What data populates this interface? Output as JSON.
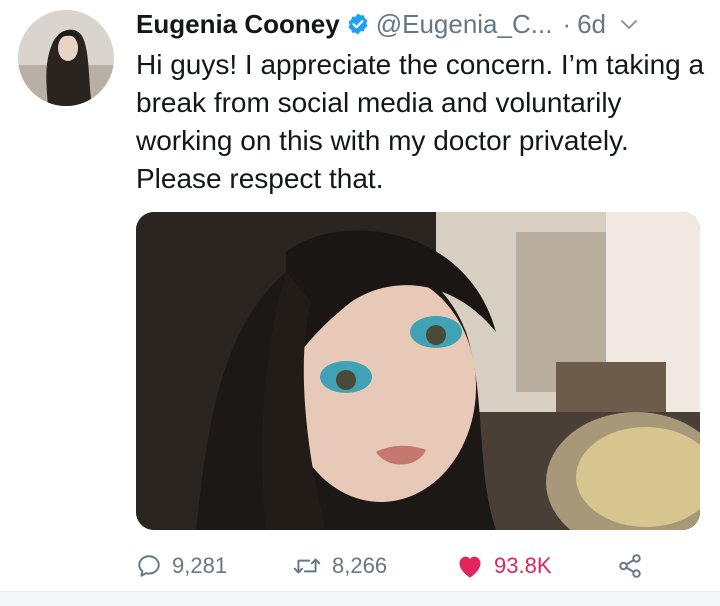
{
  "tweet": {
    "display_name": "Eugenia Cooney",
    "handle": "@Eugenia_C...",
    "separator": "·",
    "time": "6d",
    "text": "Hi guys! I appreciate the concern. I’m taking a break from social media and voluntarily working on this with my doctor privately. Please respect that."
  },
  "icons": {
    "verified": "verified-badge-icon",
    "menu": "chevron-down-icon",
    "reply": "reply-icon",
    "retweet": "retweet-icon",
    "like": "heart-icon",
    "share": "share-icon"
  },
  "stats": {
    "replies": "9,281",
    "retweets": "8,266",
    "likes": "93.8K"
  },
  "colors": {
    "brand_blue": "#1da1f2",
    "like_red": "#e0245e",
    "muted_gray": "#657786",
    "text": "#14171a"
  }
}
